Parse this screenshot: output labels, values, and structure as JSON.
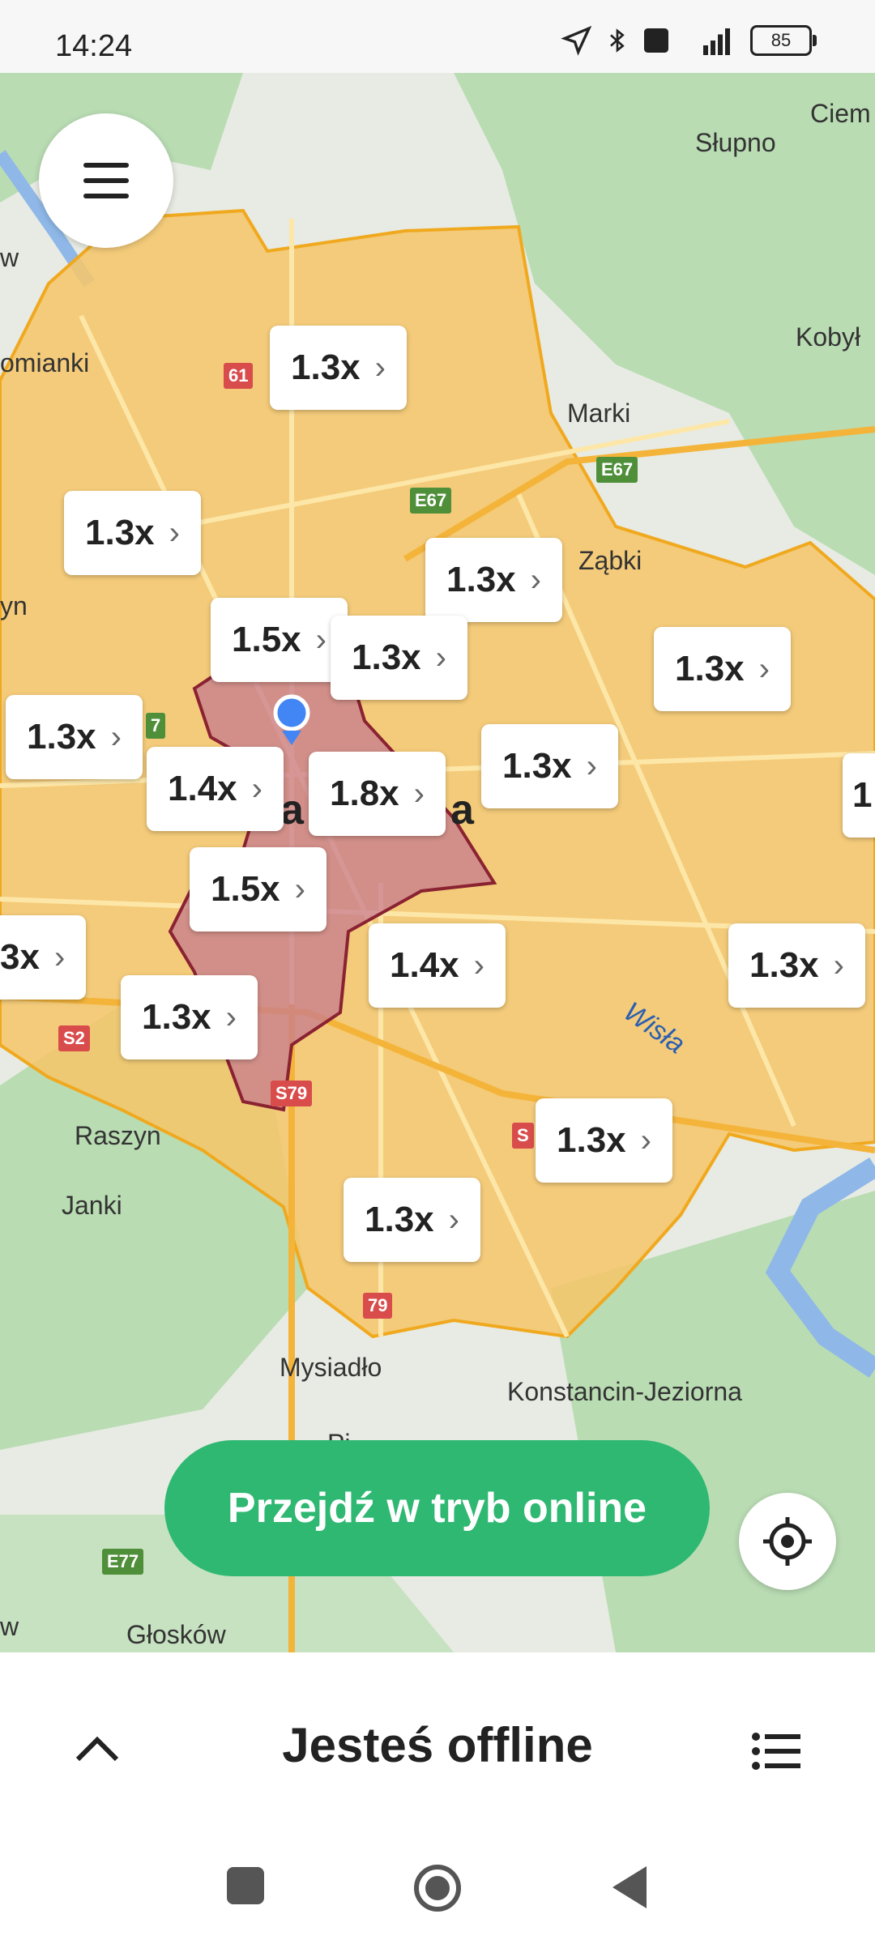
{
  "status": {
    "time": "14:24",
    "battery": "85"
  },
  "map": {
    "places": [
      "Słupno",
      "Ciem",
      "Kobył",
      "omianki",
      "Marki",
      "Ząbki",
      "yn",
      "Raszyn",
      "Janki",
      "Mysiadło",
      "Konstancin-Jeziorna",
      "Głosków",
      "w",
      "w",
      "a",
      "a",
      "Pi"
    ],
    "river": "Wisła",
    "roads": [
      "61",
      "E67",
      "E67",
      "S2",
      "S79",
      "79",
      "E77",
      "S",
      "7"
    ],
    "surge": [
      "1.3x",
      "1.3x",
      "1.3x",
      "1.5x",
      "1.3x",
      "1.3x",
      "1.3x",
      "1.4x",
      "1.8x",
      "1.3x",
      "1",
      "1.5x",
      "3x",
      "1.4x",
      "1.3x",
      "1.3x",
      "1.3x",
      "1.3x"
    ]
  },
  "actions": {
    "go_online": "Przejdź w tryb online"
  },
  "panel": {
    "title": "Jesteś offline"
  },
  "colors": {
    "zone": "#f5c66b",
    "high_zone": "#c77b8f",
    "online": "#2eb872",
    "water": "#8fb8e8",
    "green": "#b9dcb3"
  },
  "icons": {
    "menu": "hamburger-icon",
    "locate": "crosshair-icon",
    "expand": "chevron-up-icon",
    "list": "list-icon",
    "user_location": "location-dot-icon"
  }
}
